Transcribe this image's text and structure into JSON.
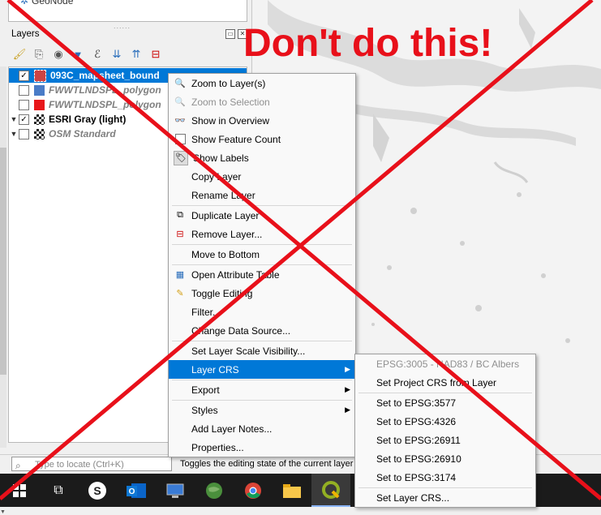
{
  "browser": {
    "item": "GeoNode"
  },
  "layers_panel": {
    "title": "Layers",
    "dock_buttons": [
      "restore-icon",
      "close-icon"
    ],
    "toolbar_icons": [
      "open-layer-styling-icon",
      "add-group-icon",
      "manage-visibility-icon",
      "filter-legend-icon",
      "filter-expression-icon",
      "expand-all-icon",
      "collapse-all-icon",
      "remove-layer-icon"
    ],
    "layers": [
      {
        "name": "093C_mapsheet_bound",
        "checked": true,
        "selected": true
      },
      {
        "name": "FWWTLNDSPL_polygon",
        "checked": false,
        "swatch": "#4a7cc7"
      },
      {
        "name": "FWWTLNDSPL_polygon",
        "checked": false,
        "swatch": "#e8171a"
      },
      {
        "name": "ESRI Gray (light)",
        "checked": true
      },
      {
        "name": "OSM Standard",
        "checked": false
      }
    ]
  },
  "context_menu": {
    "items": [
      {
        "label": "Zoom to Layer(s)",
        "icon": "zoom-icon"
      },
      {
        "label": "Zoom to Selection",
        "icon": "zoom-selection-icon",
        "disabled": true
      },
      {
        "label": "Show in Overview",
        "icon": "overview-icon"
      },
      {
        "label": "Show Feature Count",
        "icon": "checkbox-icon"
      },
      {
        "label": "Show Labels",
        "icon": "labels-icon"
      },
      {
        "label": "Copy Layer"
      },
      {
        "label": "Rename Layer"
      },
      {
        "label": "Duplicate Layer",
        "icon": "duplicate-icon"
      },
      {
        "label": "Remove Layer...",
        "icon": "remove-icon"
      },
      {
        "label": "Move to Bottom"
      },
      {
        "label": "Open Attribute Table",
        "icon": "table-icon"
      },
      {
        "label": "Toggle Editing",
        "icon": "pencil-icon"
      },
      {
        "label": "Filter..."
      },
      {
        "label": "Change Data Source..."
      },
      {
        "label": "Set Layer Scale Visibility..."
      },
      {
        "label": "Layer CRS",
        "highlight": true
      },
      {
        "label": "Export"
      },
      {
        "label": "Styles"
      },
      {
        "label": "Add Layer Notes..."
      },
      {
        "label": "Properties..."
      }
    ]
  },
  "crs_submenu": {
    "items": [
      {
        "label": "EPSG:3005 - NAD83 / BC Albers",
        "disabled": true
      },
      {
        "label": "Set Project CRS from Layer"
      },
      {
        "label": "Set to EPSG:3577"
      },
      {
        "label": "Set to EPSG:4326"
      },
      {
        "label": "Set to EPSG:26911"
      },
      {
        "label": "Set to EPSG:26910"
      },
      {
        "label": "Set to EPSG:3174"
      },
      {
        "label": "Set Layer CRS..."
      }
    ]
  },
  "statusbar": {
    "locate_placeholder": "Type to locate (Ctrl+K)",
    "message": "Toggles the editing state of the current layer"
  },
  "taskbar": {
    "icons": [
      "windows-start-icon",
      "task-view-icon",
      "s-app-icon",
      "outlook-icon",
      "remote-desktop-icon",
      "globe-app-icon",
      "chrome-icon",
      "file-explorer-icon",
      "qgis-icon"
    ]
  },
  "overlay": {
    "warning_text": "Don't do this!",
    "color": "#e8101a"
  }
}
